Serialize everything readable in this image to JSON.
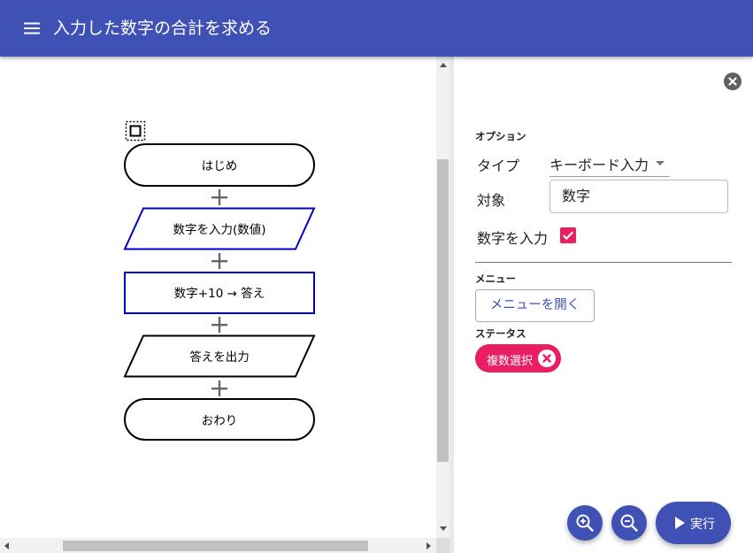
{
  "app": {
    "title": "入力した数字の合計を求める",
    "menu_icon": "hamburger-menu-icon",
    "header_color": "#3f51b5"
  },
  "flowchart": {
    "nodes": [
      {
        "label": "はじめ",
        "shape": "terminal",
        "selected": false
      },
      {
        "label": "数字を入力(数値)",
        "shape": "input",
        "selected": true
      },
      {
        "label": "数字+10 → 答え",
        "shape": "process",
        "selected": true
      },
      {
        "label": "答えを出力",
        "shape": "output",
        "selected": false
      },
      {
        "label": "おわり",
        "shape": "terminal",
        "selected": false
      }
    ],
    "selection_color": "#0000cc",
    "connector_icon": "plus-icon",
    "selection_tool_icon": "select-frame-icon"
  },
  "panel": {
    "options_label": "オプション",
    "type_label": "タイプ",
    "type_value": "キーボード入力",
    "target_label": "対象",
    "target_value": "数字",
    "input_label": "数字を入力",
    "input_checked": true,
    "menu_label": "メニュー",
    "menu_button": "メニューを開く",
    "status_label": "ステータス",
    "status_chip": "複数選択",
    "accent_color": "#e91e63"
  },
  "fabs": {
    "zoom_in_icon": "zoom-in-icon",
    "zoom_out_icon": "zoom-out-icon",
    "run_label": "実行"
  }
}
